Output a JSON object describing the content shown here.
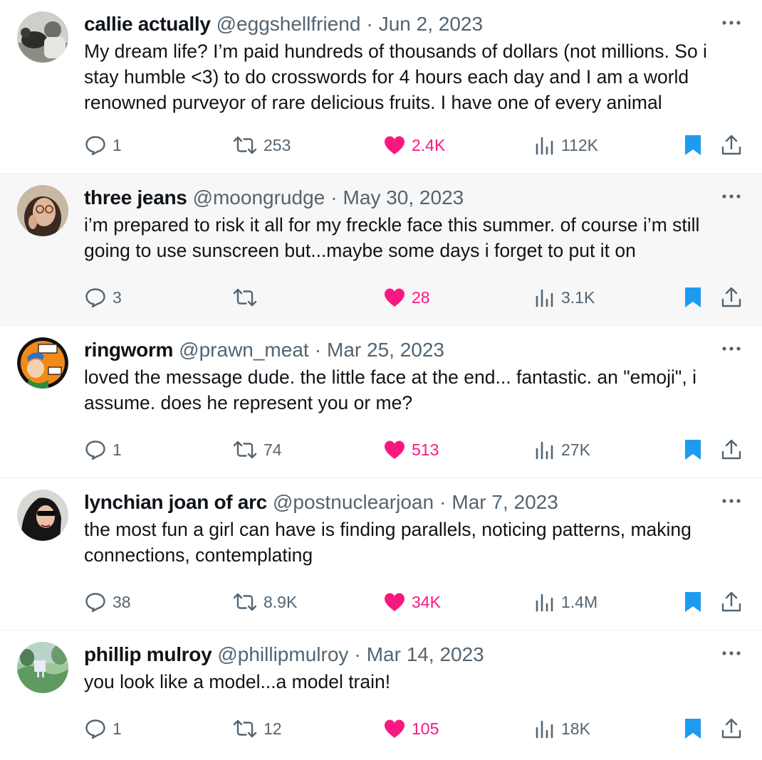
{
  "feed": {
    "tweets": [
      {
        "name": "callie actually",
        "handle": "@eggshellfriend",
        "date": "Jun 2, 2023",
        "text": "My dream life? I’m paid hundreds of thousands of dollars (not millions. So i stay humble <3) to do crosswords for 4 hours each day and I am a world renowned purveyor of rare delicious fruits. I have one of every animal",
        "replies": "1",
        "retweets": "253",
        "likes": "2.4K",
        "views": "112K",
        "liked": true,
        "bookmarked": true
      },
      {
        "name": "three jeans",
        "handle": "@moongrudge",
        "date": "May 30, 2023",
        "text": "i’m prepared to risk it all for my freckle face this summer. of course i’m still going to use sunscreen but...maybe some days i forget to put it on",
        "replies": "3",
        "retweets": "",
        "likes": "28",
        "views": "3.1K",
        "liked": true,
        "bookmarked": true,
        "highlighted": true
      },
      {
        "name": "ringworm",
        "handle": "@prawn_meat",
        "date": "Mar 25, 2023",
        "text": "loved the message dude. the little face at the end... fantastic. an \"emoji\", i assume. does he represent you or me?",
        "replies": "1",
        "retweets": "74",
        "likes": "513",
        "views": "27K",
        "liked": true,
        "bookmarked": true
      },
      {
        "name": "lynchian joan of arc",
        "handle": "@postnuclearjoan",
        "date": "Mar 7, 2023",
        "text": "the most fun a girl can have is finding parallels, noticing patterns, making connections, contemplating",
        "replies": "38",
        "retweets": "8.9K",
        "likes": "34K",
        "views": "1.4M",
        "liked": true,
        "bookmarked": true
      },
      {
        "name": "phillip mulroy",
        "handle": "@phillipmulroy",
        "date": "Mar 14, 2023",
        "text": "you look like a model...a model train!",
        "replies": "1",
        "retweets": "12",
        "likes": "105",
        "views": "18K",
        "liked": true,
        "bookmarked": true
      }
    ]
  },
  "ui": {
    "separator": "·",
    "colors": {
      "like": "#f91880",
      "bookmark": "#1d9bf0",
      "muted": "#536471",
      "text": "#0f1419",
      "highlight_bg": "#f7f7f7"
    },
    "icons": [
      "reply-icon",
      "retweet-icon",
      "heart-icon",
      "views-icon",
      "bookmark-icon",
      "share-icon",
      "more-icon"
    ]
  }
}
